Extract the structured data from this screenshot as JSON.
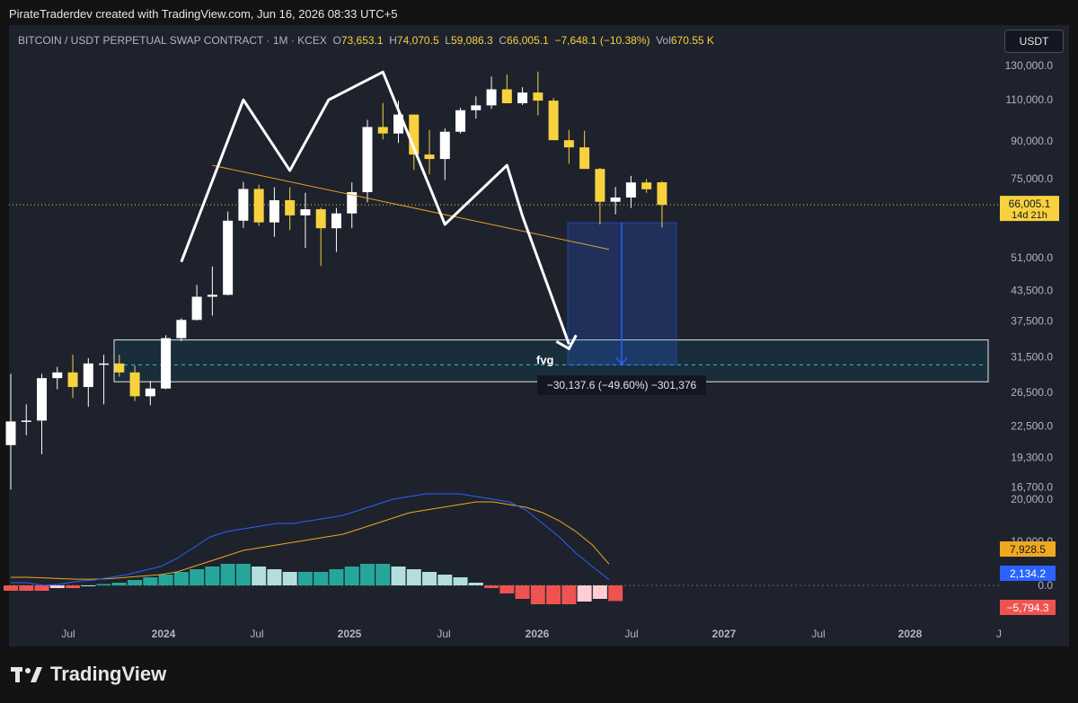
{
  "credit": "PirateTraderdev created with TradingView.com, Jun 16, 2026 08:33 UTC+5",
  "header": {
    "symbol": "BITCOIN / USDT PERPETUAL SWAP CONTRACT · 1M · KCEX",
    "o_label": "O",
    "o": "73,653.1",
    "h_label": "H",
    "h": "74,070.5",
    "l_label": "L",
    "l": "59,086.3",
    "c_label": "C",
    "c": "66,005.1",
    "chg": "−7,648.1 (−10.38%)",
    "vol_label": "Vol",
    "vol": "670.55 K"
  },
  "currency_button": "USDT",
  "brand": "TradingView",
  "colors": {
    "up": "#ffffff",
    "down": "#f7d23e",
    "macd": "#2962ff",
    "signal": "#f0a81e",
    "hist_pos": "#26a69a",
    "hist_pos_light": "#b2dfdb",
    "hist_neg": "#ef5350",
    "hist_neg_light": "#ffcdd2"
  },
  "chart_data": {
    "type": "candlestick",
    "timeframe": "1M",
    "y_scale": "log",
    "price_ticks": [
      "130,000.0",
      "110,000.0",
      "90,000.0",
      "75,000.0",
      "66,005.1",
      "51,000.0",
      "43,500.0",
      "37,500.0",
      "31,500.0",
      "26,500.0",
      "22,500.0",
      "19,300.0",
      "16,700.0"
    ],
    "last_price": "66,005.1",
    "countdown": "14d 21h",
    "x_ticks": [
      "Jul",
      "2024",
      "Jul",
      "2025",
      "Jul",
      "2026",
      "Jul",
      "2027",
      "Jul",
      "2028",
      "J"
    ],
    "candles": [
      {
        "o": 20500,
        "h": 29000,
        "l": 16500,
        "c": 23000
      },
      {
        "o": 23000,
        "h": 25000,
        "l": 21500,
        "c": 23100
      },
      {
        "o": 23100,
        "h": 29000,
        "l": 19600,
        "c": 28400
      },
      {
        "o": 28400,
        "h": 30000,
        "l": 26900,
        "c": 29200
      },
      {
        "o": 29200,
        "h": 31800,
        "l": 25800,
        "c": 27200
      },
      {
        "o": 27200,
        "h": 31300,
        "l": 24700,
        "c": 30500
      },
      {
        "o": 30500,
        "h": 31800,
        "l": 25000,
        "c": 30500
      },
      {
        "o": 30500,
        "h": 31800,
        "l": 28600,
        "c": 29200
      },
      {
        "o": 29200,
        "h": 30200,
        "l": 25400,
        "c": 26000
      },
      {
        "o": 26000,
        "h": 28000,
        "l": 24900,
        "c": 27000
      },
      {
        "o": 27000,
        "h": 35000,
        "l": 26900,
        "c": 34500
      },
      {
        "o": 34500,
        "h": 38000,
        "l": 34000,
        "c": 37700
      },
      {
        "o": 37700,
        "h": 44700,
        "l": 37600,
        "c": 42200
      },
      {
        "o": 42200,
        "h": 48900,
        "l": 38500,
        "c": 42600
      },
      {
        "o": 42600,
        "h": 63900,
        "l": 42500,
        "c": 61100
      },
      {
        "o": 61100,
        "h": 73800,
        "l": 59000,
        "c": 71300
      },
      {
        "o": 71300,
        "h": 72800,
        "l": 59600,
        "c": 60600
      },
      {
        "o": 60600,
        "h": 71900,
        "l": 56500,
        "c": 67500
      },
      {
        "o": 67500,
        "h": 71900,
        "l": 58400,
        "c": 62700
      },
      {
        "o": 62700,
        "h": 70000,
        "l": 53500,
        "c": 64600
      },
      {
        "o": 64600,
        "h": 65100,
        "l": 49000,
        "c": 58900
      },
      {
        "o": 58900,
        "h": 65000,
        "l": 52500,
        "c": 63300
      },
      {
        "o": 63300,
        "h": 73600,
        "l": 58900,
        "c": 70200
      },
      {
        "o": 70200,
        "h": 99800,
        "l": 66800,
        "c": 96400
      },
      {
        "o": 96400,
        "h": 108300,
        "l": 90700,
        "c": 93400
      },
      {
        "o": 93400,
        "h": 109600,
        "l": 89200,
        "c": 102400
      },
      {
        "o": 102400,
        "h": 102500,
        "l": 78200,
        "c": 84300
      },
      {
        "o": 84300,
        "h": 95000,
        "l": 76600,
        "c": 82500
      },
      {
        "o": 82500,
        "h": 95700,
        "l": 74500,
        "c": 94200
      },
      {
        "o": 94200,
        "h": 105800,
        "l": 93400,
        "c": 104600
      },
      {
        "o": 104600,
        "h": 111900,
        "l": 100400,
        "c": 107100
      },
      {
        "o": 107100,
        "h": 123200,
        "l": 105300,
        "c": 115800
      },
      {
        "o": 115800,
        "h": 124500,
        "l": 112000,
        "c": 108200
      },
      {
        "o": 108200,
        "h": 117000,
        "l": 107300,
        "c": 114000
      },
      {
        "o": 114000,
        "h": 126200,
        "l": 102000,
        "c": 109600
      },
      {
        "o": 109600,
        "h": 111000,
        "l": 94000,
        "c": 90400
      },
      {
        "o": 90400,
        "h": 95000,
        "l": 80600,
        "c": 87300
      },
      {
        "o": 87300,
        "h": 94600,
        "l": 84000,
        "c": 78600
      },
      {
        "o": 78600,
        "h": 79000,
        "l": 60000,
        "c": 67000
      },
      {
        "o": 67000,
        "h": 72000,
        "l": 63000,
        "c": 68400
      },
      {
        "o": 68400,
        "h": 76000,
        "l": 65000,
        "c": 73600
      },
      {
        "o": 73600,
        "h": 74800,
        "l": 70000,
        "c": 71200
      },
      {
        "o": 73653.1,
        "h": 74070.5,
        "l": 59086.3,
        "c": 66005.1
      }
    ],
    "projection_path": [
      [
        11,
        50000
      ],
      [
        15,
        110000
      ],
      [
        18,
        78000
      ],
      [
        20.5,
        110000
      ],
      [
        24,
        126000
      ],
      [
        28,
        60000
      ],
      [
        32,
        80000
      ],
      [
        33,
        62500
      ],
      [
        36,
        33500
      ]
    ],
    "trendline": {
      "from": [
        13,
        80000
      ],
      "to": [
        38,
        56000
      ]
    },
    "fvg_zone": {
      "label": "fvg",
      "top": 34200,
      "bottom": 27900,
      "mid": 30300
    },
    "measure": {
      "label": "−30,137.6 (−49.60%) −301,376",
      "from": 60500,
      "to": 30300
    },
    "macd": {
      "macd_line": [
        1,
        1,
        0,
        0.5,
        1.5,
        2,
        3,
        4,
        5.5,
        7,
        10,
        14,
        18,
        20,
        21,
        22,
        23,
        23,
        24,
        25,
        26,
        28,
        30,
        32,
        33,
        34,
        34,
        34,
        33,
        32,
        31,
        28,
        23,
        18,
        12,
        7,
        2.1
      ],
      "signal_line": [
        3,
        3,
        2.8,
        2.5,
        2.3,
        2.3,
        2.5,
        3,
        3.5,
        4,
        5,
        7,
        9,
        11,
        13,
        14,
        15,
        16,
        17,
        18,
        19,
        21,
        23,
        25,
        27,
        28,
        29,
        30,
        31,
        31,
        30,
        29,
        27,
        24,
        20,
        15,
        7.9
      ],
      "histogram": [
        -2,
        -2,
        -2,
        -1,
        -1,
        0,
        0.5,
        1,
        2,
        3,
        4,
        5,
        6,
        7,
        8,
        8,
        7,
        6,
        5,
        5,
        5,
        6,
        7,
        8,
        8,
        7,
        6,
        5,
        4,
        3,
        1,
        -1,
        -3,
        -5,
        -7,
        -7,
        -7,
        -6,
        -5,
        -5.8
      ],
      "labels": {
        "signal": "7,928.5",
        "macd": "2,134.2",
        "hist": "−5,794.3"
      },
      "ticks": [
        "20,000.0",
        "10,000.0",
        "0.0"
      ]
    }
  }
}
